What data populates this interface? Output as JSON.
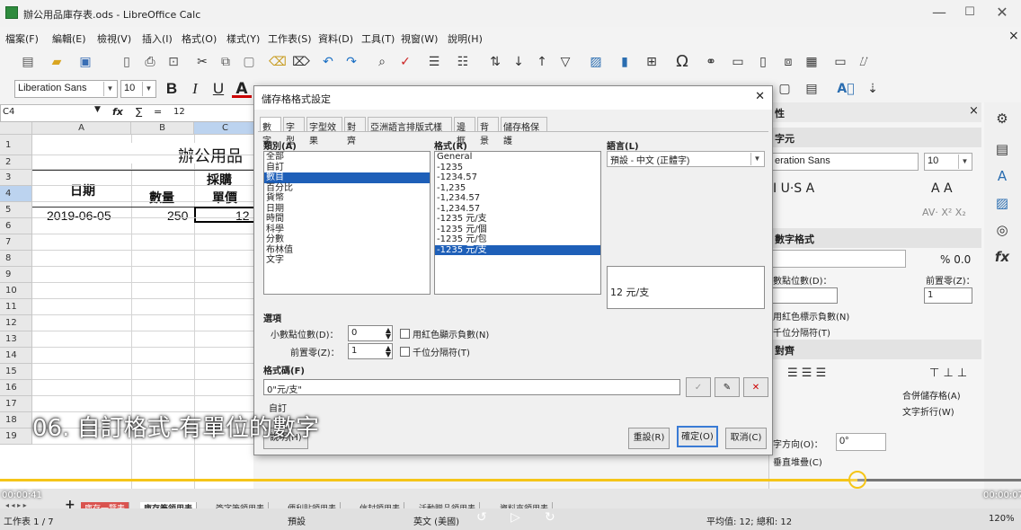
{
  "window": {
    "title": "辦公用品庫存表.ods - LibreOffice Calc",
    "minimize": "—",
    "maximize": "☐",
    "close": "✕",
    "menu_close": "×"
  },
  "menu": [
    "檔案(F)",
    "編輯(E)",
    "檢視(V)",
    "插入(I)",
    "格式(O)",
    "樣式(Y)",
    "工作表(S)",
    "資料(D)",
    "工具(T)",
    "視窗(W)",
    "說明(H)"
  ],
  "toolbar": {
    "font_name": "Liberation Sans",
    "font_size": "10",
    "bold": "B",
    "italic": "I",
    "underline": "U",
    "underline_a": "A"
  },
  "formula": {
    "cell_ref": "C4",
    "fx": "fx",
    "sum": "∑",
    "eq": "=",
    "value": "12"
  },
  "sheet": {
    "columns": [
      "A",
      "B",
      "C"
    ],
    "rows": [
      "1",
      "2",
      "3",
      "4",
      "5",
      "6",
      "7",
      "8",
      "9",
      "10",
      "11",
      "12",
      "13",
      "14",
      "15",
      "16",
      "17",
      "18",
      "19"
    ],
    "title": "辦公用品",
    "date_header": "日期",
    "purchase_header": "採購",
    "qty_header": "數量",
    "price_header": "單價",
    "a4": "2019-06-05",
    "b4": "250",
    "c4": "12"
  },
  "dialog": {
    "title": "儲存格格式設定",
    "close": "✕",
    "tabs": [
      "數字",
      "字型",
      "字型效果",
      "對齊",
      "亞洲語言排版式樣",
      "邊框",
      "背景",
      "儲存格保護"
    ],
    "category_label": "類別(A)",
    "categories": [
      "全部",
      "自訂",
      "數目",
      "百分比",
      "貨幣",
      "日期",
      "時間",
      "科學",
      "分數",
      "布林值",
      "文字"
    ],
    "format_label": "格式(R)",
    "formats": [
      "General",
      "-1235",
      "-1234.57",
      "-1,235",
      "-1,234.57",
      "-1,234.57",
      "-1235 元/支",
      "-1235 元/個",
      "-1235 元/包",
      "-1235 元/支"
    ],
    "language_label": "語言(L)",
    "language_value": "預設 - 中文 (正體字)",
    "preview": "12 元/支",
    "options_label": "選項",
    "decimals_label": "小數點位數(D)：",
    "decimals_value": "0",
    "leading_zeros_label": "前置零(Z)：",
    "leading_zeros_value": "1",
    "negative_red_label": "用紅色顯示負數(N)",
    "thousands_label": "千位分隔符(T)",
    "format_code_label": "格式碼(F)",
    "format_code": "0\"元/支\"",
    "custom_label": "自訂",
    "help": "說明(H)",
    "reset": "重設(R)",
    "ok": "確定(O)",
    "cancel": "取消(C)"
  },
  "sidebar": {
    "header": "性",
    "char_section": "字元",
    "font": "eration Sans",
    "size": "10",
    "number_section": "數字格式",
    "decimals": "數點位數(D)：",
    "leading": "前置零(Z)：",
    "leading_value": "1",
    "neg_red": "用紅色標示負數(N)",
    "thousands": "千位分隔符(T)",
    "align_section": "對齊",
    "merge": "合併儲存格(A)",
    "wrap": "文字折行(W)",
    "text_dir": "字方向(O)：",
    "angle": "0°",
    "vertical_stack": "垂直堆疊(C)",
    "bg": "背景(B)：",
    "pct_00": "% 0.0"
  },
  "sheet_tabs": [
    "庫存一覽表",
    "庫存筆領用表",
    "簽字筆領用表",
    "便利貼領用表",
    "信封領用表",
    "活動贈品領用表",
    "資料夾領用表"
  ],
  "status": {
    "sheet": "工作表 1 / 7",
    "style": "預設",
    "lang": "英文 (美國)",
    "sum": "平均值: 12; 總和: 12",
    "zoom": "120%"
  },
  "video": {
    "caption": "06. 自訂格式-有單位的數字",
    "time_left": "00:00:41",
    "time_right": "00:00:07",
    "progress": 0.84
  }
}
